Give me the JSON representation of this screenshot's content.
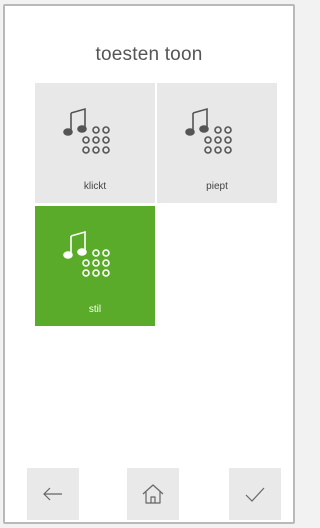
{
  "screen": {
    "title": "toesten toon"
  },
  "options": [
    {
      "id": "klickt",
      "label": "klickt",
      "selected": false,
      "icon": "keypad-sound-icon"
    },
    {
      "id": "piept",
      "label": "piept",
      "selected": false,
      "icon": "keypad-sound-icon"
    },
    {
      "id": "stil",
      "label": "stil",
      "selected": true,
      "icon": "keypad-sound-icon"
    }
  ],
  "nav": {
    "back_icon": "arrow-left-icon",
    "home_icon": "home-icon",
    "confirm_icon": "checkmark-icon"
  },
  "colors": {
    "accent": "#5aab29",
    "tile": "#e8e8e8",
    "icon_stroke": "#555555",
    "selected_text": "#ffffff"
  }
}
